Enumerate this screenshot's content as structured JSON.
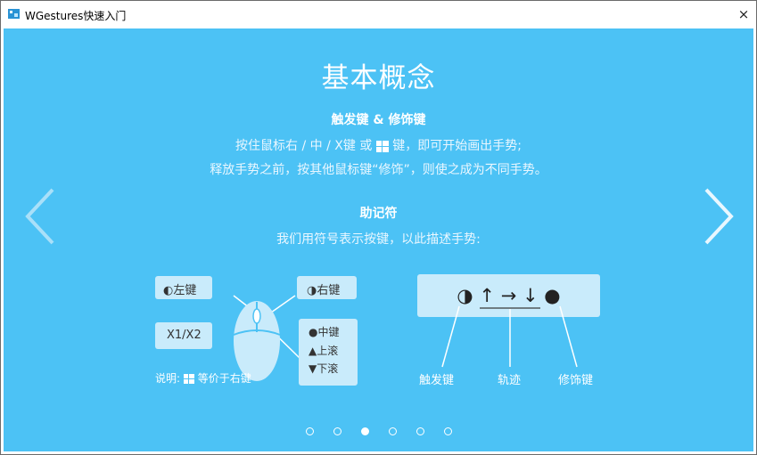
{
  "window": {
    "title": "WGestures快速入门",
    "close_glyph": "×"
  },
  "page": {
    "heading": "基本概念",
    "section1": {
      "title": "触发键 & 修饰键",
      "line1_before": "按住鼠标右 / 中 / X键 或",
      "line1_after": "键，即可开始画出手势;",
      "line2": "释放手势之前，按其他鼠标键“修饰”，则使之成为不同手势。"
    },
    "section2": {
      "title": "助记符",
      "line1": "我们用符号表示按键，以此描述手势:"
    }
  },
  "mouse_diagram": {
    "left_key": "◐左键",
    "right_key": "◑右键",
    "x_keys": "X1/X2",
    "middle": [
      "●中键",
      "▲上滚",
      "▼下滚"
    ],
    "note_before": "说明:",
    "note_after": "等价于右键"
  },
  "mnemonic_diagram": {
    "symbols": "◑ ↑ → ↓ ●",
    "labels": {
      "trigger": "触发键",
      "track": "轨迹",
      "modifier": "修饰键"
    }
  },
  "pagination": {
    "count": 6,
    "active_index": 2
  },
  "colors": {
    "background": "#4cc2f5",
    "box": "#c9ebfb",
    "text": "#ffffff"
  }
}
